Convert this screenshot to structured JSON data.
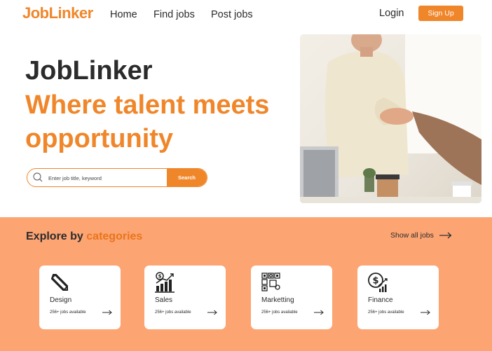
{
  "brand": {
    "name": "JobLinker",
    "color": "#f0862a"
  },
  "nav": {
    "links": [
      {
        "label": "Home"
      },
      {
        "label": "Find jobs"
      },
      {
        "label": "Post jobs"
      }
    ],
    "login_label": "Login",
    "signup_label": "Sign Up"
  },
  "hero": {
    "title": "JobLinker",
    "tagline": "Where talent meets opportunity",
    "search": {
      "placeholder": "Enter job title, keyword",
      "button_label": "Search"
    }
  },
  "categories": {
    "heading_prefix": "Explore by",
    "heading_accent": "categories",
    "show_all_label": "Show all jobs",
    "section_color": "#fda473",
    "items": [
      {
        "name": "Design",
        "count": "256+ jobs available",
        "icon": "design-tools-icon"
      },
      {
        "name": "Sales",
        "count": "256+ jobs available",
        "icon": "sales-chart-icon"
      },
      {
        "name": "Marketting",
        "count": "256+ jobs available",
        "icon": "marketing-icon"
      },
      {
        "name": "Finance",
        "count": "256+ jobs available",
        "icon": "finance-icon"
      }
    ]
  }
}
